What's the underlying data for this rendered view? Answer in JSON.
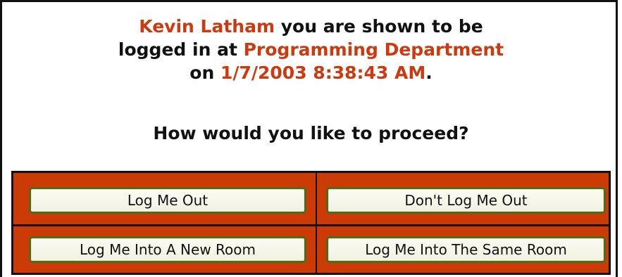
{
  "message": {
    "user_name": "Kevin Latham",
    "text_1": " you are shown to be",
    "text_2": "logged in at ",
    "location": "Programming Department",
    "text_3": "on ",
    "timestamp": "1/7/2003 8:38:43 AM",
    "text_4": "."
  },
  "prompt": "How would you like to proceed?",
  "buttons": {
    "log_out": "Log Me Out",
    "dont_log_out": "Don't Log Me Out",
    "new_room": "Log Me Into A New Room",
    "same_room": "Log Me Into The Same Room"
  },
  "colors": {
    "highlight": "#cc3a10",
    "panel": "#cc3a05",
    "button_border": "#4f6b18"
  }
}
